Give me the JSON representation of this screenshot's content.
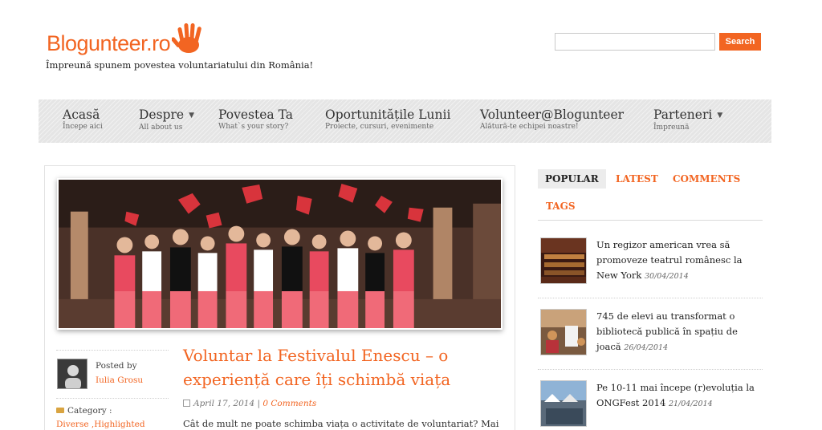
{
  "header": {
    "logo_text": "Blogunteer.ro",
    "tagline": "Împreună spunem povestea voluntariatului din România!",
    "search": {
      "placeholder": "",
      "button_label": "Search"
    }
  },
  "nav": [
    {
      "title": "Acasă",
      "subtitle": "Începe aici",
      "has_dropdown": false
    },
    {
      "title": "Despre",
      "subtitle": "All about us",
      "has_dropdown": true
    },
    {
      "title": "Povestea Ta",
      "subtitle": "What`s your story?",
      "has_dropdown": false
    },
    {
      "title": "Oportunitățile Lunii",
      "subtitle": "Proiecte, cursuri, evenimente",
      "has_dropdown": false
    },
    {
      "title": "Volunteer@Blogunteer",
      "subtitle": "Alătură-te echipei noastre!",
      "has_dropdown": false
    },
    {
      "title": "Parteneri",
      "subtitle": "Împreună",
      "has_dropdown": true
    }
  ],
  "post": {
    "posted_by_label": "Posted by",
    "author": "Iulia Grosu",
    "category_label": "Category :",
    "categories": "Diverse ,Highlighted",
    "title": "Voluntar la Festivalul Enescu – o experiență care îți schimbă viața",
    "date": "April 17, 2014",
    "separator": "|",
    "comments": "0 Comments",
    "excerpt": "Cât de mult ne poate schimba viața o activitate de voluntariat? Mai"
  },
  "sidebar": {
    "tabs": [
      "POPULAR",
      "LATEST",
      "COMMENTS",
      "TAGS"
    ],
    "active_tab": "POPULAR",
    "items": [
      {
        "title": "Un regizor american vrea să promoveze teatrul românesc la New York",
        "date": "30/04/2014"
      },
      {
        "title": "745 de elevi au transformat o bibliotecă publică în spațiu de joacă",
        "date": "26/04/2014"
      },
      {
        "title": "Pe 10-11 mai începe (r)evoluția la ONGFest 2014",
        "date": "21/04/2014"
      }
    ]
  },
  "colors": {
    "accent": "#f26522",
    "nav_bg": "#e5e5e5",
    "text": "#333333"
  },
  "icons": {
    "logo": "hand-icon",
    "dropdown": "caret-down-icon",
    "date": "calendar-icon",
    "category": "folder-icon"
  }
}
